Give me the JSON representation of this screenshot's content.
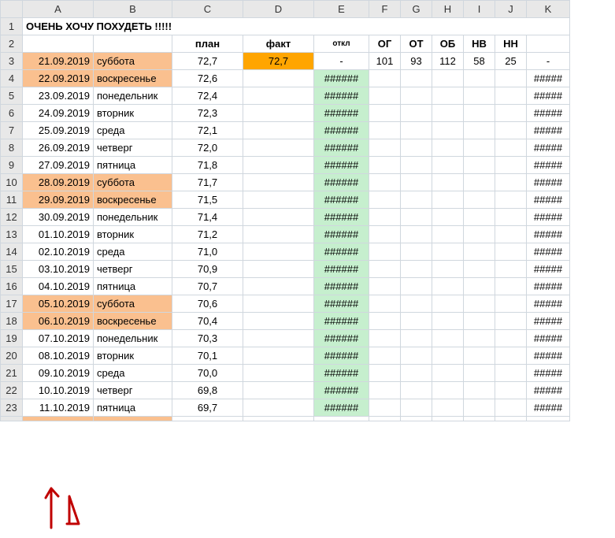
{
  "columns": [
    "",
    "A",
    "B",
    "C",
    "D",
    "E",
    "F",
    "G",
    "H",
    "I",
    "J",
    "K"
  ],
  "title": "ОЧЕНЬ ХОЧУ ПОХУДЕТЬ !!!!!",
  "header_row": {
    "plan": "план",
    "fact": "факт",
    "otkl": "откл",
    "og": "ОГ",
    "ot": "ОТ",
    "ob": "ОБ",
    "hb": "НВ",
    "hn": "НН"
  },
  "first_row": {
    "date": "21.09.2019",
    "day": "суббота",
    "plan": "72,7",
    "fact": "72,7",
    "otkl": "-",
    "og": "101",
    "ot": "93",
    "ob": "112",
    "hb": "58",
    "hn": "25",
    "k": "-"
  },
  "rows": [
    {
      "n": 4,
      "date": "22.09.2019",
      "day": "воскресенье",
      "plan": "72,6",
      "weekend": true
    },
    {
      "n": 5,
      "date": "23.09.2019",
      "day": "понедельник",
      "plan": "72,4",
      "weekend": false
    },
    {
      "n": 6,
      "date": "24.09.2019",
      "day": "вторник",
      "plan": "72,3",
      "weekend": false
    },
    {
      "n": 7,
      "date": "25.09.2019",
      "day": "среда",
      "plan": "72,1",
      "weekend": false
    },
    {
      "n": 8,
      "date": "26.09.2019",
      "day": "четверг",
      "plan": "72,0",
      "weekend": false
    },
    {
      "n": 9,
      "date": "27.09.2019",
      "day": "пятница",
      "plan": "71,8",
      "weekend": false
    },
    {
      "n": 10,
      "date": "28.09.2019",
      "day": "суббота",
      "plan": "71,7",
      "weekend": true
    },
    {
      "n": 11,
      "date": "29.09.2019",
      "day": "воскресенье",
      "plan": "71,5",
      "weekend": true
    },
    {
      "n": 12,
      "date": "30.09.2019",
      "day": "понедельник",
      "plan": "71,4",
      "weekend": false
    },
    {
      "n": 13,
      "date": "01.10.2019",
      "day": "вторник",
      "plan": "71,2",
      "weekend": false
    },
    {
      "n": 14,
      "date": "02.10.2019",
      "day": "среда",
      "plan": "71,0",
      "weekend": false
    },
    {
      "n": 15,
      "date": "03.10.2019",
      "day": "четверг",
      "plan": "70,9",
      "weekend": false
    },
    {
      "n": 16,
      "date": "04.10.2019",
      "day": "пятница",
      "plan": "70,7",
      "weekend": false
    },
    {
      "n": 17,
      "date": "05.10.2019",
      "day": "суббота",
      "plan": "70,6",
      "weekend": true
    },
    {
      "n": 18,
      "date": "06.10.2019",
      "day": "воскресенье",
      "plan": "70,4",
      "weekend": true
    },
    {
      "n": 19,
      "date": "07.10.2019",
      "day": "понедельник",
      "plan": "70,3",
      "weekend": false
    },
    {
      "n": 20,
      "date": "08.10.2019",
      "day": "вторник",
      "plan": "70,1",
      "weekend": false
    },
    {
      "n": 21,
      "date": "09.10.2019",
      "day": "среда",
      "plan": "70,0",
      "weekend": false
    },
    {
      "n": 22,
      "date": "10.10.2019",
      "day": "четверг",
      "plan": "69,8",
      "weekend": false
    },
    {
      "n": 23,
      "date": "11.10.2019",
      "day": "пятница",
      "plan": "69,7",
      "weekend": false
    }
  ],
  "hash": "######",
  "hash5": "#####",
  "annotation_label": "1"
}
